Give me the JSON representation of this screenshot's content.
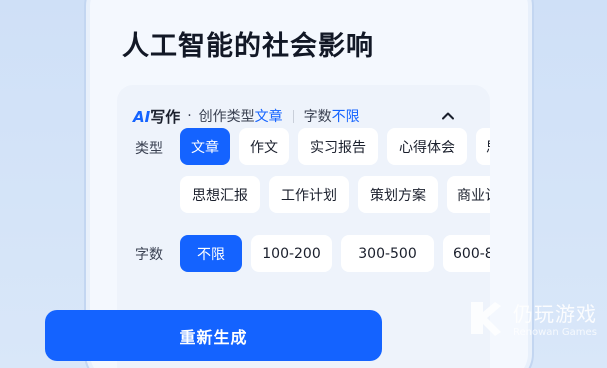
{
  "page": {
    "title": "人工智能的社会影响"
  },
  "panel": {
    "brand_ai": "AI",
    "brand_write": "写作",
    "dot": "·",
    "mode_prefix": "创作类型",
    "mode_value": "文章",
    "count_prefix": "字数",
    "count_value": "不限",
    "collapse_icon": "chevron-up-icon"
  },
  "type_row": {
    "label": "类型",
    "row1": [
      "文章",
      "作文",
      "实习报告",
      "心得体会",
      "思"
    ],
    "row2": [
      "思想汇报",
      "工作计划",
      "策划方案",
      "商业计"
    ]
  },
  "count_row": {
    "label": "字数",
    "options": [
      "不限",
      "100-200",
      "300-500",
      "600-8"
    ]
  },
  "regen_button": {
    "label": "重新生成"
  },
  "watermark": {
    "cn": "仍玩游戏",
    "en": "Renowan Games"
  },
  "colors": {
    "accent": "#1463ff",
    "background": "#f4f8fe",
    "panel": "#eef3fb"
  }
}
